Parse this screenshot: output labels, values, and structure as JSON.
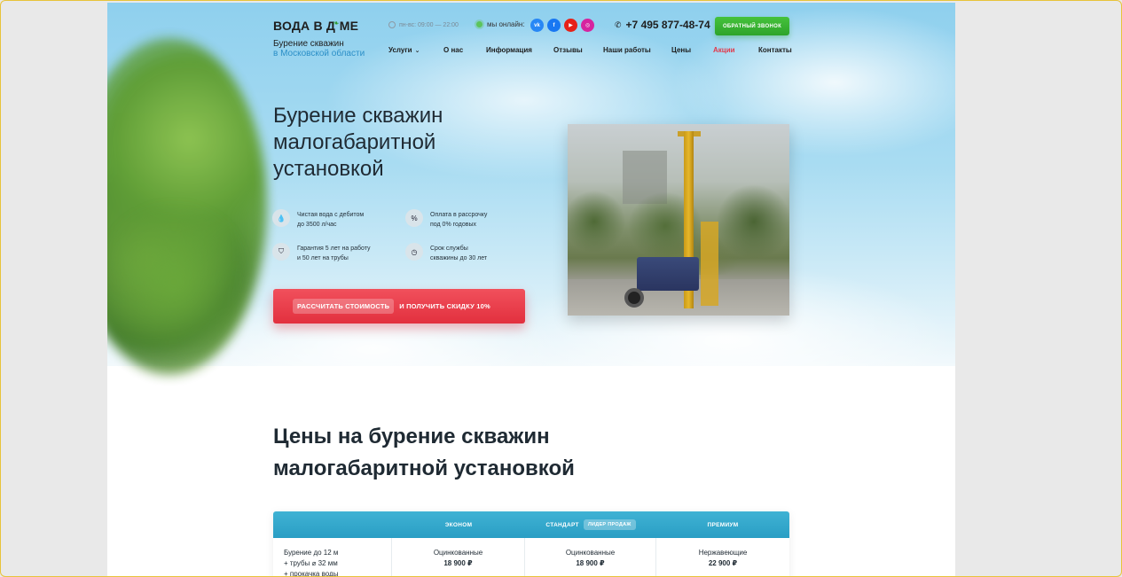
{
  "header": {
    "logo": "ВОДА В Д",
    "logo_tail": "МЕ",
    "tagline_line1": "Бурение скважин",
    "tagline_line2": "в Московской области",
    "hours": "пн-вс: 09:00 — 22:00",
    "online_label": "мы онлайн:",
    "socials": [
      {
        "name": "vk",
        "label": "vk"
      },
      {
        "name": "facebook",
        "label": "f"
      },
      {
        "name": "youtube",
        "label": "▶"
      },
      {
        "name": "instagram",
        "label": "◎"
      }
    ],
    "phone": "+7 495 877-48-74",
    "callback_label": "ОБРАТНЫЙ ЗВОНОК"
  },
  "nav": {
    "items": [
      {
        "label": "Услуги",
        "has_dropdown": true
      },
      {
        "label": "О нас"
      },
      {
        "label": "Информация"
      },
      {
        "label": "Отзывы"
      },
      {
        "label": "Наши работы"
      },
      {
        "label": "Цены"
      },
      {
        "label": "Акции",
        "accent": true
      },
      {
        "label": "Контакты"
      }
    ]
  },
  "hero": {
    "title_line1": "Бурение скважин",
    "title_line2": "малогабаритной",
    "title_line3": "установкой",
    "features": [
      {
        "icon": "water-drop-icon",
        "line1": "Чистая вода с дебитом",
        "line2": "до 3500 л/час"
      },
      {
        "icon": "percent-icon",
        "line1": "Оплата в рассрочку",
        "line2": "под 0% годовых"
      },
      {
        "icon": "shield-icon",
        "line1": "Гарантия 5 лет на работу",
        "line2": "и 50 лет на трубы"
      },
      {
        "icon": "clock-icon",
        "line1": "Срок службы",
        "line2": "скважины до 30 лет"
      }
    ],
    "cta_pill": "РАССЧИТАТЬ СТОИМОСТЬ",
    "cta_rest": "И ПОЛУЧИТЬ СКИДКУ 10%"
  },
  "prices": {
    "title_line1": "Цены на бурение скважин",
    "title_line2": "малогабаритной установкой",
    "columns": [
      {
        "label": "ЭКОНОМ"
      },
      {
        "label": "СТАНДАРТ",
        "badge": "ЛИДЕР ПРОДАЖ"
      },
      {
        "label": "ПРЕМИУМ"
      }
    ],
    "row": {
      "label_lines": [
        "Бурение до 12 м",
        "+ трубы ⌀ 32 мм",
        "+ прокачка воды"
      ],
      "cells": [
        {
          "name": "Оцинкованные",
          "price": "18 900 ₽"
        },
        {
          "name": "Оцинкованные",
          "price": "18 900 ₽"
        },
        {
          "name": "Нержавеющие",
          "price": "22 900 ₽"
        }
      ]
    }
  },
  "colors": {
    "accent_red": "#e2303e",
    "accent_green": "#2ea42a",
    "table_header": "#2a9ec4",
    "link_blue": "#2b8fc7"
  }
}
